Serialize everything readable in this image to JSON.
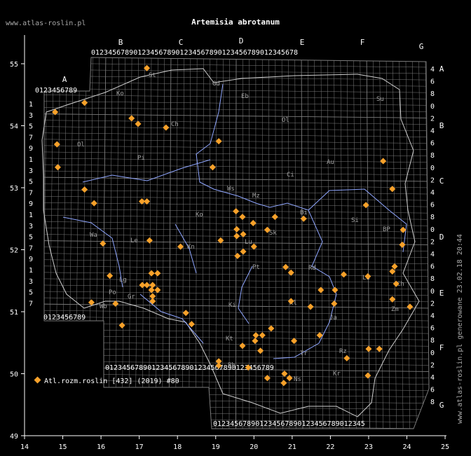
{
  "site_label": "www.atlas-roslin.pl",
  "title": "Artemisia abrotanum",
  "legend_label": "Atl.rozm.roslin [432] (2019) #80",
  "generated_label": "www.atlas-roslin.pl generowane 23.02.18 20:44",
  "colors": {
    "background": "#000000",
    "grid": "#7c7c7c",
    "axis": "#ffffff",
    "river": "#8fa6ff",
    "border": "#cfcfcf",
    "marker": "#f7a12a"
  },
  "lon_ticks": [
    "14",
    "15",
    "16",
    "17",
    "18",
    "19",
    "20",
    "21",
    "22",
    "23",
    "24",
    "25"
  ],
  "lat_ticks": [
    "49",
    "50",
    "51",
    "52",
    "53",
    "54",
    "55"
  ],
  "column_letters": [
    "A",
    "B",
    "C",
    "D",
    "E",
    "F",
    "G"
  ],
  "row_letters": [
    "A",
    "B",
    "C",
    "D",
    "E",
    "F",
    "G"
  ],
  "top_digits_row1": "0123456789012345678901234567890123456789012345678",
  "top_digits_row2": "0123456789",
  "bottom_digits_row1": "0123456789",
  "bottom_digits_row2": "0123456789012345678901234567890123456789",
  "bottom_digits_row3": "012345678901234567890123456789012345",
  "left_row_digits": [
    "1",
    "3",
    "5",
    "7",
    "9",
    "1",
    "3",
    "5",
    "7",
    "9",
    "1",
    "3",
    "5",
    "7",
    "9",
    "1",
    "3",
    "5",
    "7"
  ],
  "right_row_digits": [
    "4",
    "6",
    "8",
    "0",
    "2",
    "4",
    "6",
    "8",
    "0",
    "2",
    "4",
    "6",
    "8",
    "0",
    "2",
    "4",
    "6",
    "8",
    "0",
    "2",
    "4",
    "6",
    "8",
    "0",
    "2",
    "4",
    "6",
    "8"
  ],
  "region_codes": [
    "St",
    "Ko",
    "Gd",
    "Eb",
    "Su",
    "Ch",
    "Ol",
    "Pi",
    "Ci",
    "Au",
    "Ws",
    "Mz",
    "Ko",
    "Bi",
    "Si",
    "BP",
    "Le",
    "Kn",
    "Sk",
    "Lu",
    "Wa",
    "Pt",
    "Rd",
    "Ch",
    "Kl",
    "La",
    "Wb",
    "Lg",
    "Ki",
    "Kt",
    "Tr",
    "Zm",
    "Ja",
    "Rz",
    "Bb",
    "Ns",
    "Kr",
    "Ol",
    "Po",
    "Gr"
  ],
  "map_data": {
    "projection": "lon-lat grid",
    "lon_range": [
      14,
      25
    ],
    "lat_range": [
      49,
      55.5
    ],
    "records": [
      {
        "lon": 17.2,
        "lat": 54.93
      },
      {
        "lon": 14.8,
        "lat": 54.22
      },
      {
        "lon": 15.57,
        "lat": 54.37
      },
      {
        "lon": 16.8,
        "lat": 54.12
      },
      {
        "lon": 16.97,
        "lat": 54.03
      },
      {
        "lon": 17.7,
        "lat": 53.97
      },
      {
        "lon": 14.85,
        "lat": 53.7
      },
      {
        "lon": 19.08,
        "lat": 53.75
      },
      {
        "lon": 14.87,
        "lat": 53.33
      },
      {
        "lon": 18.92,
        "lat": 53.33
      },
      {
        "lon": 23.38,
        "lat": 53.43
      },
      {
        "lon": 15.57,
        "lat": 52.97
      },
      {
        "lon": 23.62,
        "lat": 52.98
      },
      {
        "lon": 15.82,
        "lat": 52.75
      },
      {
        "lon": 17.07,
        "lat": 52.78
      },
      {
        "lon": 17.2,
        "lat": 52.78
      },
      {
        "lon": 22.93,
        "lat": 52.72
      },
      {
        "lon": 19.53,
        "lat": 52.62
      },
      {
        "lon": 19.7,
        "lat": 52.53
      },
      {
        "lon": 20.55,
        "lat": 52.53
      },
      {
        "lon": 21.3,
        "lat": 52.5
      },
      {
        "lon": 19.98,
        "lat": 52.43
      },
      {
        "lon": 19.55,
        "lat": 52.33
      },
      {
        "lon": 20.35,
        "lat": 52.32
      },
      {
        "lon": 23.9,
        "lat": 52.32
      },
      {
        "lon": 19.55,
        "lat": 52.22
      },
      {
        "lon": 19.72,
        "lat": 52.25
      },
      {
        "lon": 17.27,
        "lat": 52.15
      },
      {
        "lon": 19.13,
        "lat": 52.15
      },
      {
        "lon": 16.05,
        "lat": 52.1
      },
      {
        "lon": 18.08,
        "lat": 52.05
      },
      {
        "lon": 20.0,
        "lat": 52.05
      },
      {
        "lon": 23.88,
        "lat": 52.08
      },
      {
        "lon": 19.72,
        "lat": 51.97
      },
      {
        "lon": 19.57,
        "lat": 51.9
      },
      {
        "lon": 23.68,
        "lat": 51.73
      },
      {
        "lon": 20.83,
        "lat": 51.72
      },
      {
        "lon": 20.97,
        "lat": 51.63
      },
      {
        "lon": 23.62,
        "lat": 51.65
      },
      {
        "lon": 16.23,
        "lat": 51.58
      },
      {
        "lon": 17.32,
        "lat": 51.62
      },
      {
        "lon": 17.48,
        "lat": 51.62
      },
      {
        "lon": 22.35,
        "lat": 51.6
      },
      {
        "lon": 22.98,
        "lat": 51.57
      },
      {
        "lon": 17.08,
        "lat": 51.43
      },
      {
        "lon": 17.2,
        "lat": 51.43
      },
      {
        "lon": 17.35,
        "lat": 51.43
      },
      {
        "lon": 23.72,
        "lat": 51.45
      },
      {
        "lon": 17.32,
        "lat": 51.35
      },
      {
        "lon": 17.48,
        "lat": 51.35
      },
      {
        "lon": 21.75,
        "lat": 51.35
      },
      {
        "lon": 22.12,
        "lat": 51.35
      },
      {
        "lon": 17.35,
        "lat": 51.25
      },
      {
        "lon": 17.35,
        "lat": 51.17
      },
      {
        "lon": 23.62,
        "lat": 51.2
      },
      {
        "lon": 20.97,
        "lat": 51.17
      },
      {
        "lon": 22.1,
        "lat": 51.13
      },
      {
        "lon": 16.38,
        "lat": 51.13
      },
      {
        "lon": 15.75,
        "lat": 51.15
      },
      {
        "lon": 21.48,
        "lat": 51.08
      },
      {
        "lon": 24.08,
        "lat": 51.08
      },
      {
        "lon": 18.22,
        "lat": 50.98
      },
      {
        "lon": 18.37,
        "lat": 50.8
      },
      {
        "lon": 16.55,
        "lat": 50.78
      },
      {
        "lon": 20.45,
        "lat": 50.73
      },
      {
        "lon": 20.05,
        "lat": 50.62
      },
      {
        "lon": 20.22,
        "lat": 50.62
      },
      {
        "lon": 21.72,
        "lat": 50.62
      },
      {
        "lon": 20.03,
        "lat": 50.53
      },
      {
        "lon": 21.05,
        "lat": 50.53
      },
      {
        "lon": 19.7,
        "lat": 50.45
      },
      {
        "lon": 23.0,
        "lat": 50.4
      },
      {
        "lon": 23.28,
        "lat": 50.4
      },
      {
        "lon": 20.17,
        "lat": 50.37
      },
      {
        "lon": 22.43,
        "lat": 50.25
      },
      {
        "lon": 19.08,
        "lat": 50.2
      },
      {
        "lon": 19.08,
        "lat": 50.13
      },
      {
        "lon": 19.85,
        "lat": 50.1
      },
      {
        "lon": 20.8,
        "lat": 50.0
      },
      {
        "lon": 22.98,
        "lat": 49.97
      },
      {
        "lon": 20.35,
        "lat": 49.93
      },
      {
        "lon": 20.93,
        "lat": 49.93
      },
      {
        "lon": 20.78,
        "lat": 49.85
      }
    ]
  }
}
